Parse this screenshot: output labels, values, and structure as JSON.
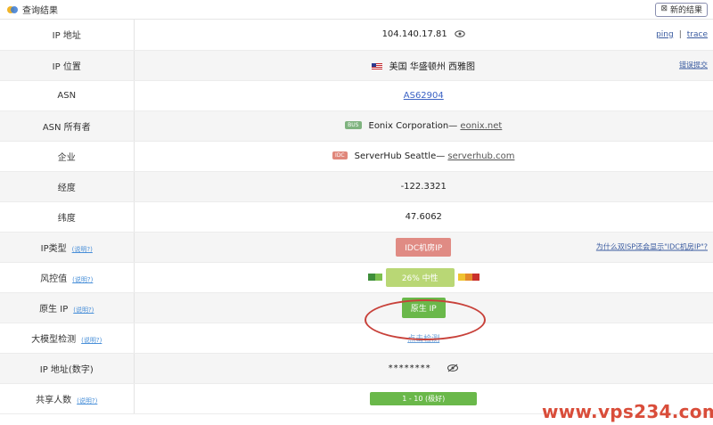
{
  "header": {
    "title": "查询结果",
    "new_query_label": "新的结果"
  },
  "rows": [
    {
      "label": "IP 地址",
      "value": "104.140.17.81",
      "links": [
        "ping",
        "trace"
      ]
    },
    {
      "label": "IP 位置",
      "value": "美国 华盛顿州 西雅图",
      "right": "错误提交"
    },
    {
      "label": "ASN",
      "value": "AS62904"
    },
    {
      "label": "ASN 所有者",
      "tag": "BUS",
      "name": "Eonix Corporation—",
      "link": "eonix.net"
    },
    {
      "label": "企业",
      "tag": "IDC",
      "name": "ServerHub Seattle—",
      "link": "serverhub.com"
    },
    {
      "label": "经度",
      "value": "-122.3321"
    },
    {
      "label": "纬度",
      "value": "47.6062"
    },
    {
      "label": "IP类型",
      "help": "(说明?)",
      "value": "IDC机房IP",
      "right": "为什么双ISP还会显示\"IDC机房IP\"?"
    },
    {
      "label": "风控值",
      "help": "(说明?)",
      "value": "26%  中性"
    },
    {
      "label": "原生 IP",
      "help": "(说明?)",
      "value": "原生 IP"
    },
    {
      "label": "大模型检测",
      "help": "(说明?)",
      "value": "点击检测"
    },
    {
      "label": "IP 地址(数字)",
      "value": "********"
    },
    {
      "label": "共享人数",
      "help": "(说明?)",
      "value": "1 - 10 (极好)"
    }
  ],
  "colors": {
    "risk_green": "#b9d775",
    "native_green": "#6ab84a",
    "idc_red": "#e08b84",
    "annotation_red": "#c8413a"
  },
  "icons": [
    "eye-icon",
    "eye-off-icon",
    "close-icon",
    "us-flag-icon"
  ],
  "watermark": "www.vps234.com"
}
